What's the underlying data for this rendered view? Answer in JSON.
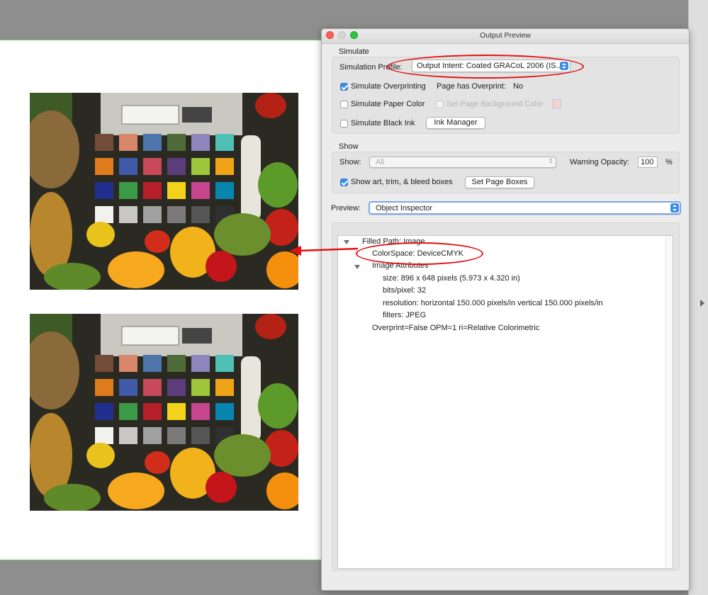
{
  "dialog": {
    "title": "Output Preview",
    "simulate": {
      "section_label": "Simulate",
      "profile_label": "Simulation Profile:",
      "profile_value": "Output Intent: Coated GRACoL 2006 (IS...",
      "overprinting_label": "Simulate Overprinting",
      "overprinting_checked": true,
      "page_has_overprint_label": "Page has Overprint:",
      "page_has_overprint_value": "No",
      "paper_color_label": "Simulate Paper Color",
      "paper_color_checked": false,
      "bg_color_label": "Set Page Background Color",
      "bg_color_swatch": "#f2d4d4",
      "black_ink_label": "Simulate Black Ink",
      "black_ink_checked": false,
      "ink_manager_label": "Ink Manager"
    },
    "show": {
      "section_label": "Show",
      "show_label": "Show:",
      "show_value": "All",
      "warning_opacity_label": "Warning Opacity:",
      "warning_opacity_value": "100",
      "percent": "%",
      "boxes_label": "Show art, trim, & bleed boxes",
      "boxes_checked": true,
      "set_page_boxes_label": "Set Page Boxes"
    },
    "preview": {
      "label": "Preview:",
      "value": "Object Inspector"
    },
    "inspector": {
      "filled_path": "Filled Path: Image",
      "colorspace": "ColorSpace: DeviceCMYK",
      "image_attributes": "Image Attributes",
      "size": "size: 896 x 648 pixels (5.973 x 4.320 in)",
      "bits": "bits/pixel: 32",
      "resolution": "resolution: horizontal 150.000 pixels/in vertical 150.000 pixels/in",
      "filters": "filters: JPEG",
      "overprint": "Overprint=False OPM=1 ri=Relative Colorimetric"
    }
  },
  "colors": {
    "accent": "#3b8de6",
    "annotation": "#e21010",
    "page_border": "#6dd35c"
  },
  "icons": [
    "close-light",
    "minimize-light",
    "zoom-light",
    "chevron-updown-icon",
    "disclosure-triangle-icon",
    "right-arrow-icon"
  ]
}
